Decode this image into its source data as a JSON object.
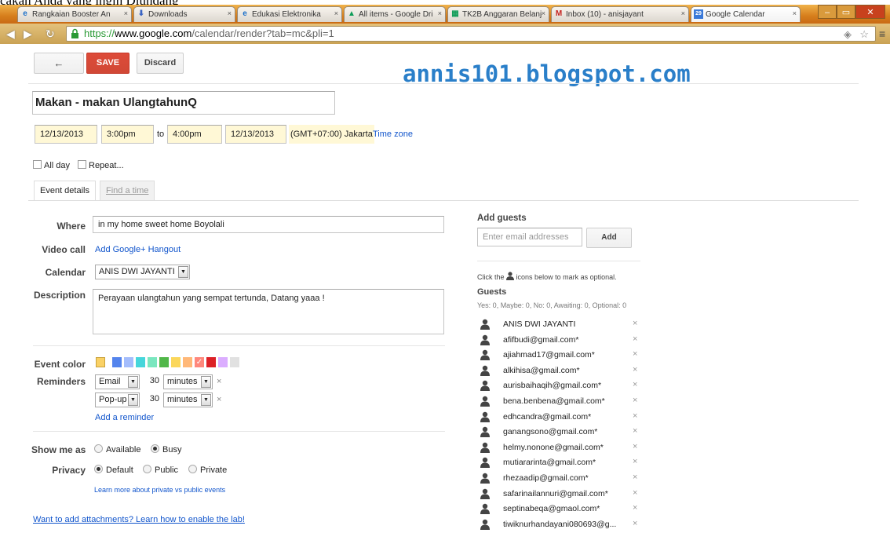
{
  "above_text": "cakan Anda yang ingin Diundang",
  "browser": {
    "tabs": [
      {
        "label": "Rangkaian Booster An",
        "icon": "e",
        "active": false
      },
      {
        "label": "Downloads",
        "icon": "⬇",
        "active": false
      },
      {
        "label": "Edukasi Elektronika",
        "icon": "e",
        "active": false
      },
      {
        "label": "All items - Google Dri",
        "icon": "▲",
        "active": false
      },
      {
        "label": "TK2B Anggaran Belanj",
        "icon": "▦",
        "active": false
      },
      {
        "label": "Inbox (10) - anisjayant",
        "icon": "M",
        "active": false
      },
      {
        "label": "Google Calendar",
        "icon": "29",
        "active": true
      }
    ],
    "url_scheme": "https://",
    "url_host": "www.google.com",
    "url_path": "/calendar/render?tab=mc&pli=1"
  },
  "toolbar": {
    "back_label": "←",
    "save_label": "SAVE",
    "discard_label": "Discard"
  },
  "watermark": "annis101.blogspot.com",
  "event": {
    "title": "Makan - makan UlangtahunQ",
    "start_date": "12/13/2013",
    "start_time": "3:00pm",
    "to_label": "to",
    "end_time": "4:00pm",
    "end_date": "12/13/2013",
    "timezone": "(GMT+07:00) Jakarta",
    "timezone_link": "Time zone",
    "all_day_label": "All day",
    "repeat_label": "Repeat..."
  },
  "detail_tabs": {
    "event_details": "Event details",
    "find_a_time": "Find a time"
  },
  "form": {
    "where_label": "Where",
    "where_value": "in my home sweet home Boyolali",
    "video_label": "Video call",
    "video_link": "Add Google+ Hangout",
    "calendar_label": "Calendar",
    "calendar_value": "ANIS DWI JAYANTI",
    "description_label": "Description",
    "description_value": "Perayaan ulangtahun yang sempat tertunda, Datang yaaa !",
    "event_color_label": "Event color",
    "event_colors": [
      "#fad165",
      "#ffffff",
      "#5484ed",
      "#a4bdfc",
      "#46d6db",
      "#7ae7bf",
      "#51b749",
      "#fbd75b",
      "#ffb878",
      "#ff887c",
      "#dc2127",
      "#dbadff",
      "#e1e1e1"
    ],
    "reminders_label": "Reminders",
    "reminders": [
      {
        "method": "Email",
        "amount": "30",
        "unit": "minutes"
      },
      {
        "method": "Pop-up",
        "amount": "30",
        "unit": "minutes"
      }
    ],
    "add_reminder": "Add a reminder",
    "show_me_as_label": "Show me as",
    "show_available": "Available",
    "show_busy": "Busy",
    "privacy_label": "Privacy",
    "privacy_default": "Default",
    "privacy_public": "Public",
    "privacy_private": "Private",
    "privacy_learn": "Learn more about private vs public events",
    "attachments_link": "Want to add attachments? Learn how to enable the lab!"
  },
  "guests": {
    "add_guests_heading": "Add guests",
    "email_placeholder": "Enter email addresses",
    "add_button": "Add",
    "optional_hint_before": "Click the",
    "optional_hint_after": "icons below to mark as optional.",
    "heading": "Guests",
    "summary": "Yes: 0, Maybe: 0, No: 0, Awaiting: 0, Optional: 0",
    "list": [
      "ANIS DWI JAYANTI",
      "afifbudi@gmail.com*",
      "ajiahmad17@gmail.com*",
      "alkihisa@gmail.com*",
      "aurisbaihaqih@gmail.com*",
      "bena.benbena@gmail.com*",
      "edhcandra@gmail.com*",
      "ganangsono@gmail.com*",
      "helmy.nonone@gmail.com*",
      "mutiararinta@gmail.com*",
      "rhezaadip@gmail.com*",
      "safarinailannuri@gmail.com*",
      "septinabeqa@gmaol.com*",
      "tiwiknurhandayani080693@g..."
    ],
    "remove_symbol": "×"
  },
  "colors": {
    "save_red": "#d14836",
    "link_blue": "#1155cc",
    "watermark_blue": "#2a7fc9",
    "highlight_yellow": "#fff8d6"
  }
}
